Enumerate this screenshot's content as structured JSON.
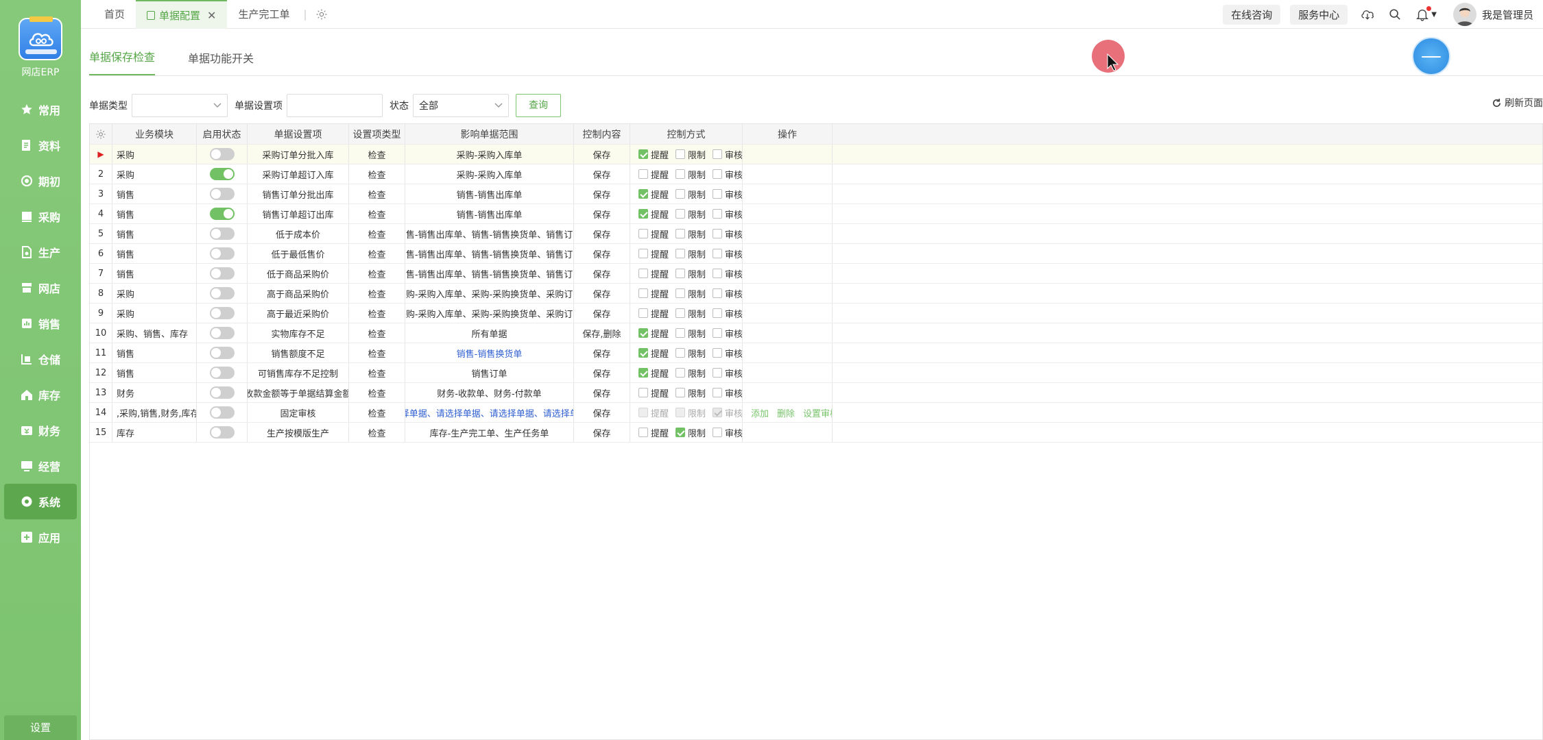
{
  "app": {
    "name": "网店ERP"
  },
  "sidebar": {
    "items": [
      {
        "label": "常用",
        "icon": "star-icon"
      },
      {
        "label": "资料",
        "icon": "document-icon"
      },
      {
        "label": "期初",
        "icon": "circle-icon"
      },
      {
        "label": "采购",
        "icon": "cart-icon"
      },
      {
        "label": "生产",
        "icon": "file-icon"
      },
      {
        "label": "网店",
        "icon": "store-icon"
      },
      {
        "label": "销售",
        "icon": "chart-icon"
      },
      {
        "label": "仓储",
        "icon": "warehouse-icon"
      },
      {
        "label": "库存",
        "icon": "home-icon"
      },
      {
        "label": "财务",
        "icon": "wallet-icon"
      },
      {
        "label": "经营",
        "icon": "screen-icon"
      },
      {
        "label": "系统",
        "icon": "gear-icon",
        "active": true
      },
      {
        "label": "应用",
        "icon": "plus-icon"
      }
    ],
    "bottom_label": "设置"
  },
  "tabs": [
    {
      "label": "首页"
    },
    {
      "label": "单据配置",
      "active": true
    },
    {
      "label": "生产完工单"
    }
  ],
  "header": {
    "online_consult": "在线咨询",
    "service_center": "服务中心",
    "user_name": "我是管理员"
  },
  "subtabs": [
    {
      "label": "单据保存检查",
      "active": true
    },
    {
      "label": "单据功能开关"
    }
  ],
  "filters": {
    "doc_type_label": "单据类型",
    "doc_type_value": "",
    "setting_label": "单据设置项",
    "setting_value": "",
    "status_label": "状态",
    "status_value": "全部",
    "query_button": "查询",
    "refresh_label": "刷新页面"
  },
  "table": {
    "headers": [
      "业务模块",
      "启用状态",
      "单据设置项",
      "设置项类型",
      "影响单据范围",
      "控制内容",
      "控制方式",
      "操作"
    ],
    "check_labels": [
      "提醒",
      "限制",
      "审核"
    ],
    "rows": [
      {
        "no": "",
        "module": "采购",
        "enabled": false,
        "item": "采购订单分批入库",
        "type": "检查",
        "scope": "采购-采购入库单",
        "content": "保存",
        "remind": true,
        "limit": false,
        "audit": false
      },
      {
        "no": "2",
        "module": "采购",
        "enabled": true,
        "item": "采购订单超订入库",
        "type": "检查",
        "scope": "采购-采购入库单",
        "content": "保存",
        "remind": false,
        "limit": false,
        "audit": false
      },
      {
        "no": "3",
        "module": "销售",
        "enabled": false,
        "item": "销售订单分批出库",
        "type": "检查",
        "scope": "销售-销售出库单",
        "content": "保存",
        "remind": true,
        "limit": false,
        "audit": false
      },
      {
        "no": "4",
        "module": "销售",
        "enabled": true,
        "item": "销售订单超订出库",
        "type": "检查",
        "scope": "销售-销售出库单",
        "content": "保存",
        "remind": true,
        "limit": false,
        "audit": false
      },
      {
        "no": "5",
        "module": "销售",
        "enabled": false,
        "item": "低于成本价",
        "type": "检查",
        "scope": "销售-销售出库单、销售-销售换货单、销售订单",
        "content": "保存",
        "remind": false,
        "limit": false,
        "audit": false
      },
      {
        "no": "6",
        "module": "销售",
        "enabled": false,
        "item": "低于最低售价",
        "type": "检查",
        "scope": "销售-销售出库单、销售-销售换货单、销售订单",
        "content": "保存",
        "remind": false,
        "limit": false,
        "audit": false
      },
      {
        "no": "7",
        "module": "销售",
        "enabled": false,
        "item": "低于商品采购价",
        "type": "检查",
        "scope": "销售-销售出库单、销售-销售换货单、销售订单",
        "content": "保存",
        "remind": false,
        "limit": false,
        "audit": false
      },
      {
        "no": "8",
        "module": "采购",
        "enabled": false,
        "item": "高于商品采购价",
        "type": "检查",
        "scope": "采购-采购入库单、采购-采购换货单、采购订单",
        "content": "保存",
        "remind": false,
        "limit": false,
        "audit": false
      },
      {
        "no": "9",
        "module": "采购",
        "enabled": false,
        "item": "高于最近采购价",
        "type": "检查",
        "scope": "采购-采购入库单、采购-采购换货单、采购订单",
        "content": "保存",
        "remind": false,
        "limit": false,
        "audit": false
      },
      {
        "no": "10",
        "module": "采购、销售、库存",
        "enabled": false,
        "item": "实物库存不足",
        "type": "检查",
        "scope": "所有单据",
        "content": "保存,删除",
        "remind": true,
        "limit": false,
        "audit": false
      },
      {
        "no": "11",
        "module": "销售",
        "enabled": false,
        "item": "销售额度不足",
        "type": "检查",
        "scope": "销售-销售换货单",
        "scope_link": true,
        "content": "保存",
        "remind": true,
        "limit": false,
        "audit": false
      },
      {
        "no": "12",
        "module": "销售",
        "enabled": false,
        "item": "可销售库存不足控制",
        "type": "检查",
        "scope": "销售订单",
        "content": "保存",
        "remind": true,
        "limit": false,
        "audit": false
      },
      {
        "no": "13",
        "module": "财务",
        "enabled": false,
        "item": "收款金额等于单据结算金额",
        "type": "检查",
        "scope": "财务-收款单、财务-付款单",
        "content": "保存",
        "remind": false,
        "limit": false,
        "audit": false
      },
      {
        "no": "14",
        "module": ",采购,销售,财务,库存",
        "enabled": false,
        "item": "固定审核",
        "type": "检查",
        "scope": "请选择单据、请选择单据、请选择单据、请选择单据...",
        "scope_link": true,
        "content": "保存",
        "remind": false,
        "limit": false,
        "audit": true,
        "disabled": true,
        "ops": [
          "添加",
          "删除",
          "设置审核人"
        ]
      },
      {
        "no": "15",
        "module": "库存",
        "enabled": false,
        "item": "生产按模版生产",
        "type": "检查",
        "scope": "库存-生产完工单、生产任务单",
        "content": "保存",
        "remind": false,
        "limit": true,
        "audit": false
      }
    ]
  }
}
